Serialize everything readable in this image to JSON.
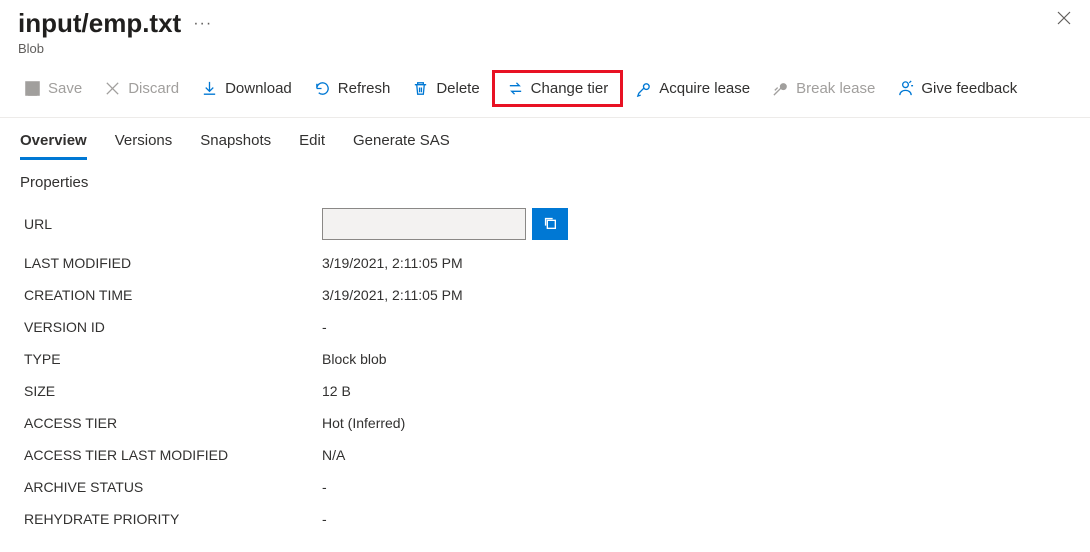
{
  "header": {
    "title": "input/emp.txt",
    "subtitle": "Blob"
  },
  "toolbar": {
    "save": "Save",
    "discard": "Discard",
    "download": "Download",
    "refresh": "Refresh",
    "delete": "Delete",
    "change_tier": "Change tier",
    "acquire_lease": "Acquire lease",
    "break_lease": "Break lease",
    "give_feedback": "Give feedback"
  },
  "tabs": {
    "overview": "Overview",
    "versions": "Versions",
    "snapshots": "Snapshots",
    "edit": "Edit",
    "generate_sas": "Generate SAS"
  },
  "section": {
    "properties": "Properties"
  },
  "properties": {
    "url_label": "URL",
    "url_value": "",
    "last_modified_label": "LAST MODIFIED",
    "last_modified_value": "3/19/2021, 2:11:05 PM",
    "creation_time_label": "CREATION TIME",
    "creation_time_value": "3/19/2021, 2:11:05 PM",
    "version_id_label": "VERSION ID",
    "version_id_value": "-",
    "type_label": "TYPE",
    "type_value": "Block blob",
    "size_label": "SIZE",
    "size_value": "12 B",
    "access_tier_label": "ACCESS TIER",
    "access_tier_value": "Hot (Inferred)",
    "access_tier_last_modified_label": "ACCESS TIER LAST MODIFIED",
    "access_tier_last_modified_value": "N/A",
    "archive_status_label": "ARCHIVE STATUS",
    "archive_status_value": "-",
    "rehydrate_priority_label": "REHYDRATE PRIORITY",
    "rehydrate_priority_value": "-"
  }
}
